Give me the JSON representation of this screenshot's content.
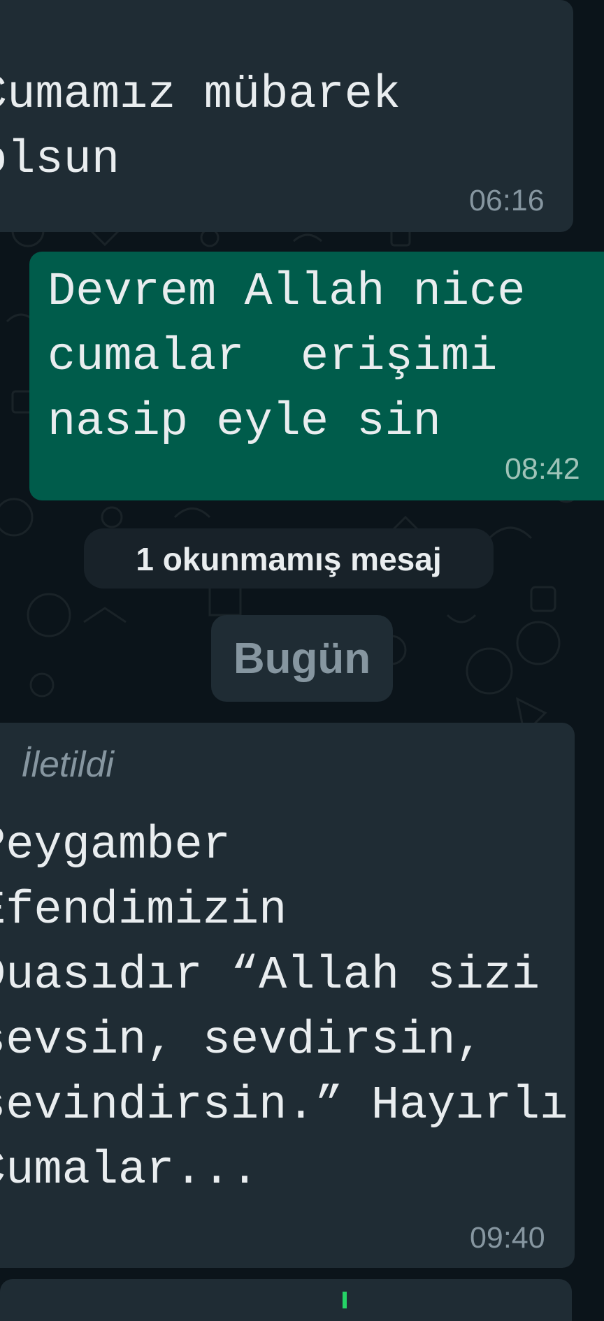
{
  "messages": [
    {
      "direction": "incoming",
      "text": "Cumamız mübarek\nolsun",
      "time": "06:16"
    },
    {
      "direction": "outgoing",
      "text": "Devrem Allah nice\ncumalar  erişimi\nnasip eyle sin",
      "time": "08:42"
    },
    {
      "direction": "incoming",
      "forwarded_label": "İletildi",
      "text": "Peygamber\nEfendimizin\nDuasıdır “Allah sizi\nsevsin, sevdirsin,\nsevindirsin.” Hayırlı\nCumalar...",
      "time": "09:40"
    }
  ],
  "unread_divider": "1 okunmamış mesaj",
  "date_divider": "Bugün",
  "colors": {
    "background": "#0b141a",
    "incoming_bubble": "#1f2c34",
    "outgoing_bubble": "#005c4b",
    "text": "#e9edef",
    "meta_text": "#8696a0",
    "accent": "#25d366"
  }
}
